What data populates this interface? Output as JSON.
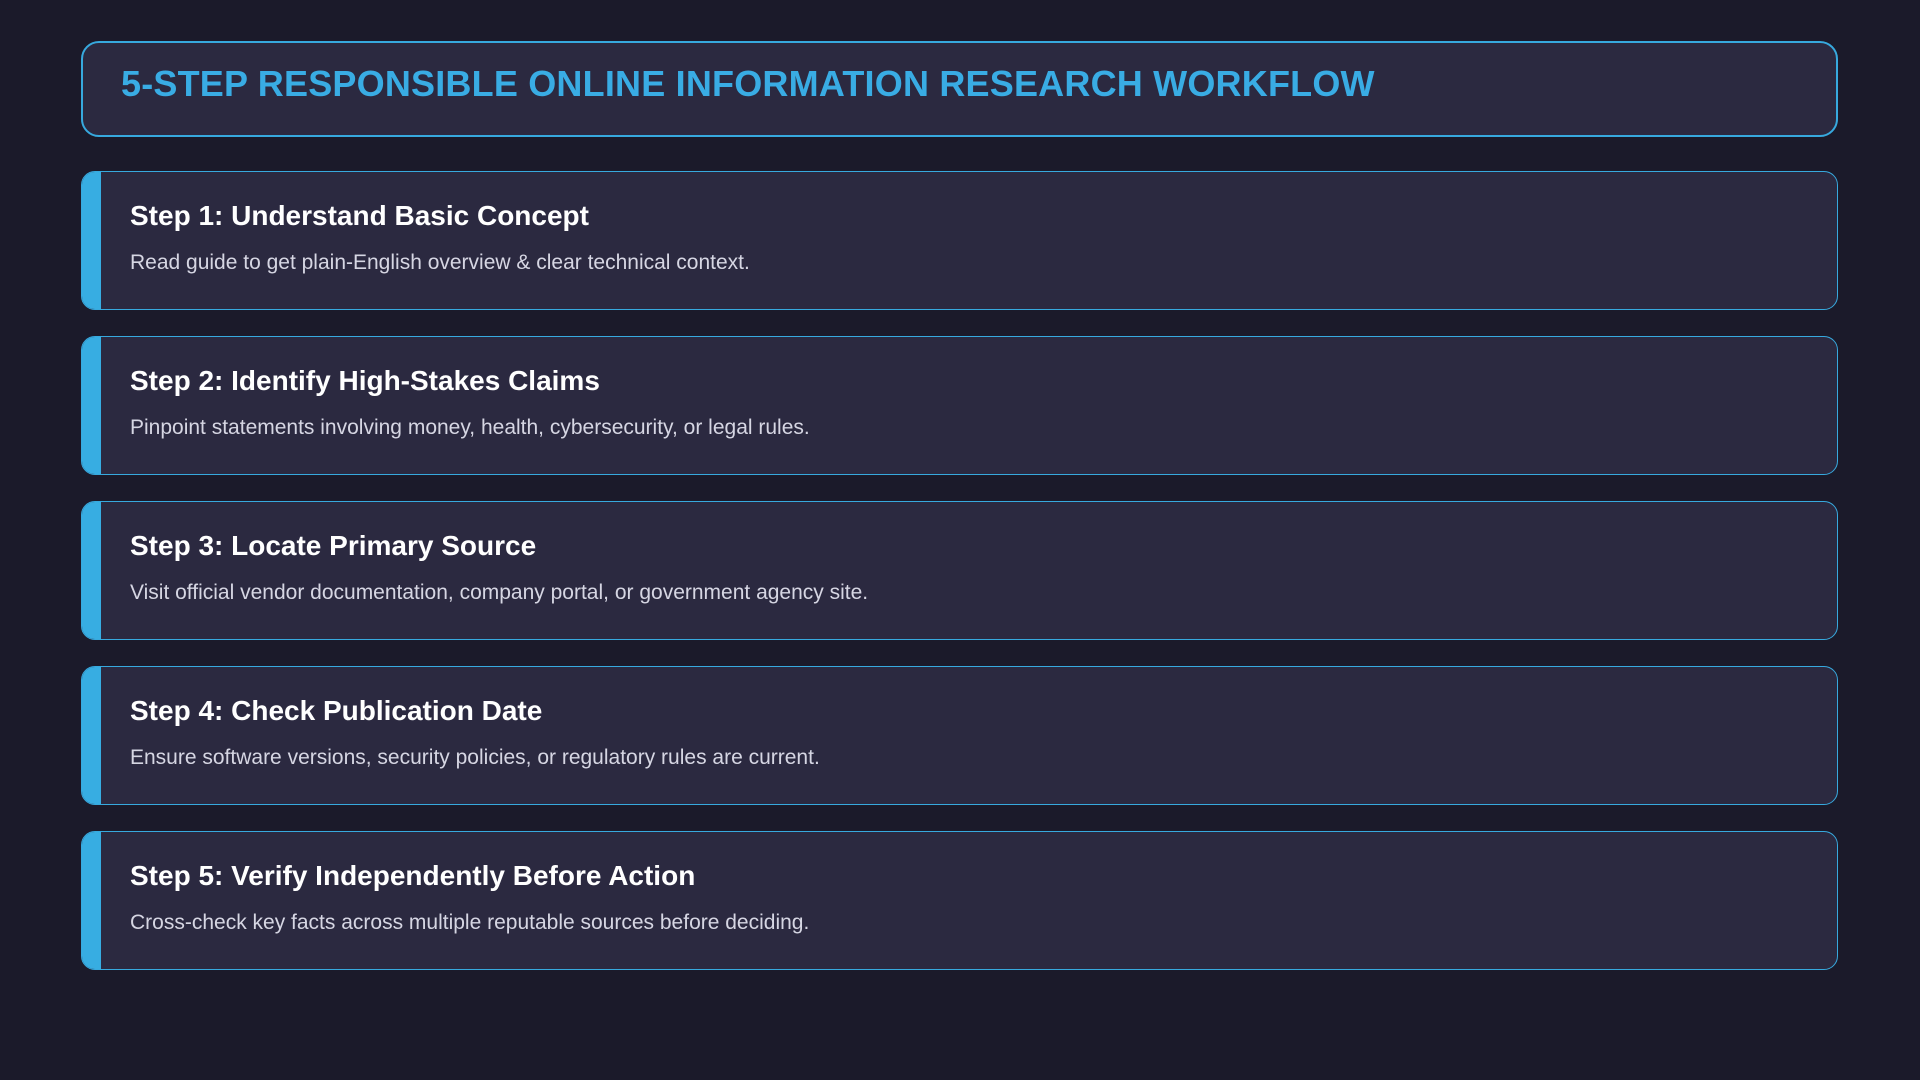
{
  "title": "5-STEP RESPONSIBLE ONLINE INFORMATION RESEARCH WORKFLOW",
  "colors": {
    "background": "#1b1a2a",
    "panel": "#2b2940",
    "accent": "#37ade2",
    "title": "#39ace4",
    "step_title": "#ffffff",
    "step_description": "#d6d6e3"
  },
  "steps": [
    {
      "title": "Step 1: Understand Basic Concept",
      "description": "Read guide to get plain-English overview & clear technical context."
    },
    {
      "title": "Step 2: Identify High-Stakes Claims",
      "description": "Pinpoint statements involving money, health, cybersecurity, or legal rules."
    },
    {
      "title": "Step 3: Locate Primary Source",
      "description": "Visit official vendor documentation, company portal, or government agency site."
    },
    {
      "title": "Step 4: Check Publication Date",
      "description": "Ensure software versions, security policies, or regulatory rules are current."
    },
    {
      "title": "Step 5: Verify Independently Before Action",
      "description": "Cross-check key facts across multiple reputable sources before deciding."
    }
  ]
}
